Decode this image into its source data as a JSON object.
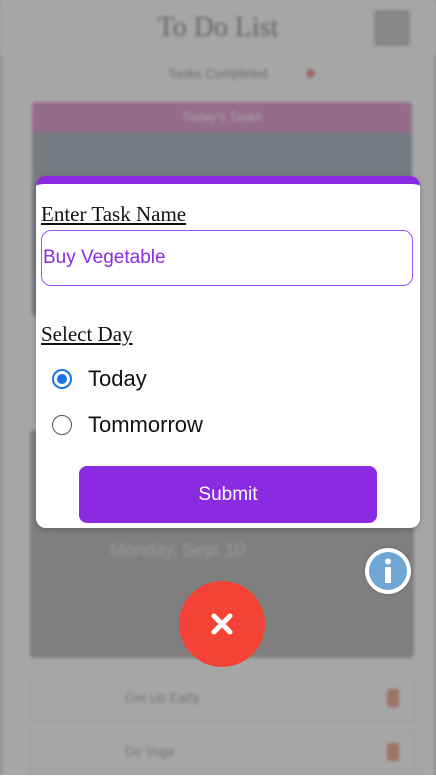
{
  "app": {
    "title": "To Do List",
    "tab_label": "Tasks Completed"
  },
  "background": {
    "card_header": "Today's Tasks",
    "card_text": "Monday, Sept 10",
    "list_items": [
      "Get Up Early",
      "Do Yoga"
    ]
  },
  "modal": {
    "task_name_label": "Enter Task Name",
    "task_name_value": "Buy Vegetable",
    "select_day_label": "Select Day",
    "options": [
      {
        "label": "Today",
        "checked": true
      },
      {
        "label": "Tommorrow",
        "checked": false
      }
    ],
    "submit_label": "Submit"
  },
  "icons": {
    "info": "info-icon",
    "close": "close-icon"
  },
  "colors": {
    "accent": "#8a2be2",
    "close_fab": "#f44336",
    "radio_selected": "#1a73e8",
    "info": "#6fa6d4"
  }
}
